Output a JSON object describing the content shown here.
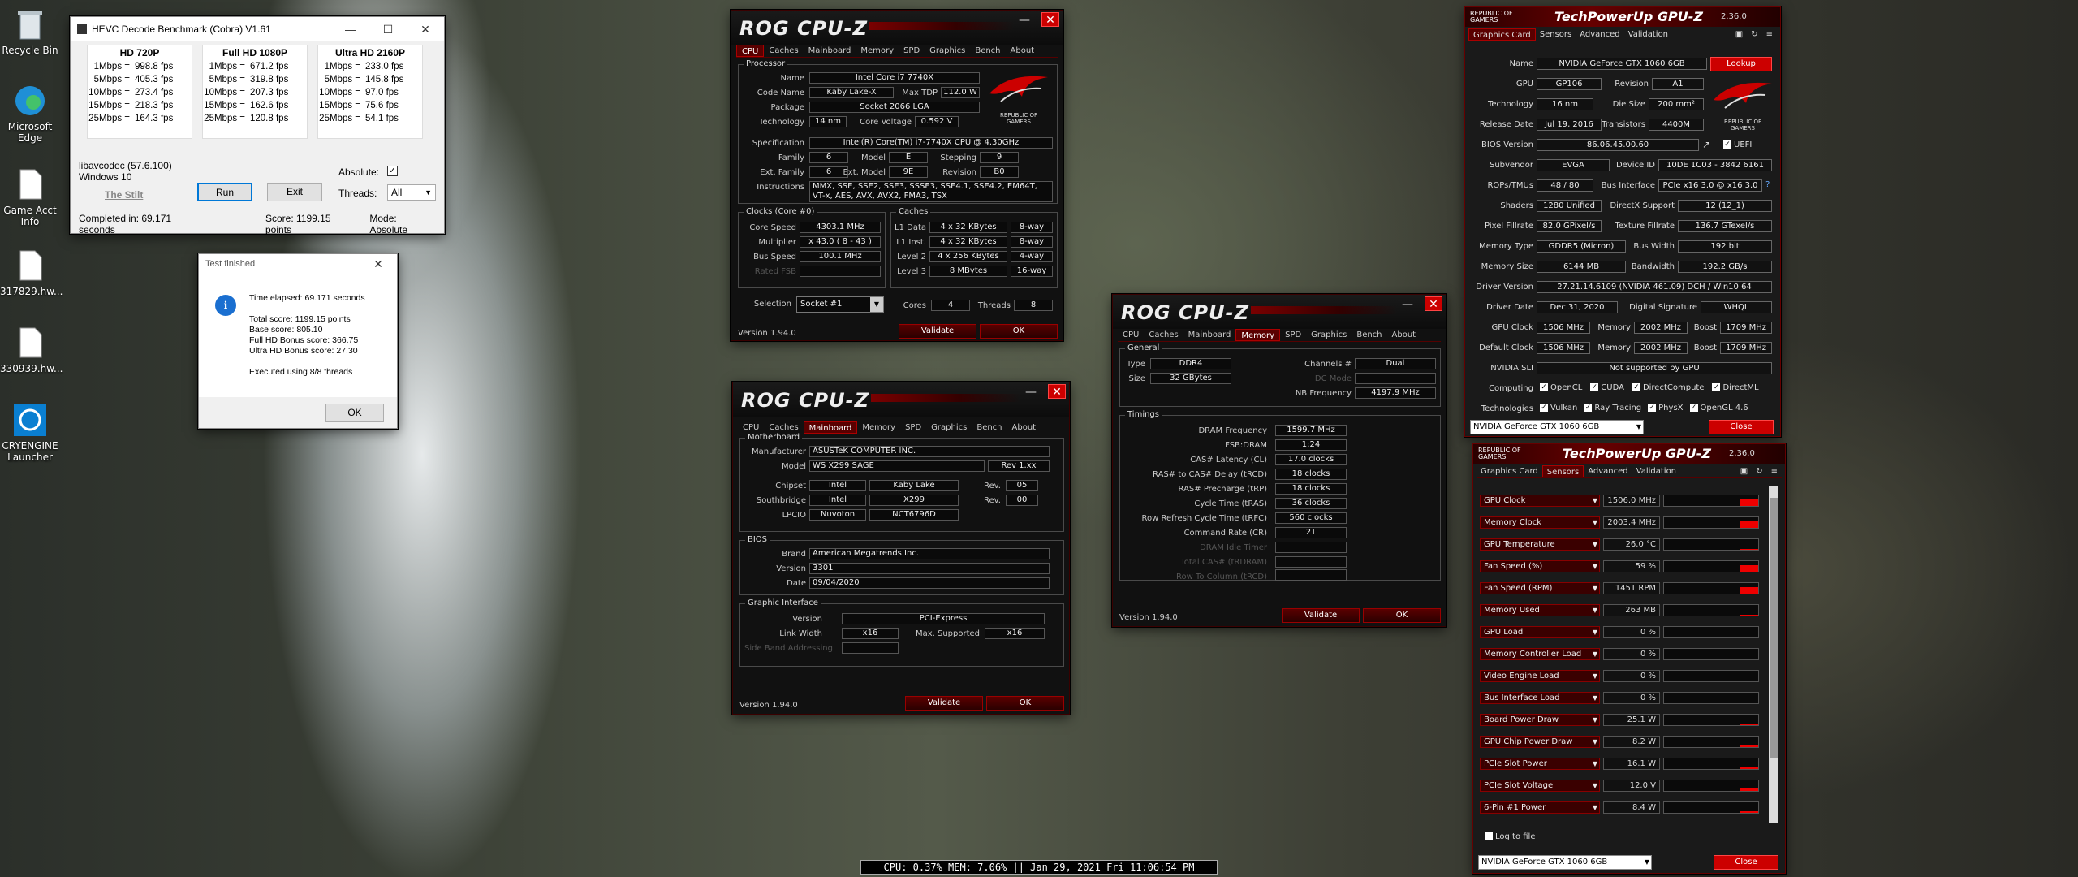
{
  "desktop": {
    "icons": [
      {
        "label": "Recycle Bin",
        "icon": "recycle-bin-icon"
      },
      {
        "label": "Microsoft Edge",
        "icon": "edge-icon"
      },
      {
        "label": "Game Acct Info",
        "icon": "document-icon"
      },
      {
        "label": "317829.hw...",
        "icon": "document-icon"
      },
      {
        "label": "330939.hw...",
        "icon": "document-icon"
      },
      {
        "label": "CRYENGINE Launcher",
        "icon": "cryengine-icon"
      }
    ]
  },
  "hevc": {
    "title": "HEVC Decode Benchmark (Cobra) V1.61",
    "cols": [
      {
        "h": "HD 720P",
        "rows": [
          [
            "1Mbps =",
            "998.8 fps"
          ],
          [
            "5Mbps =",
            "405.3 fps"
          ],
          [
            "10Mbps =",
            "273.4 fps"
          ],
          [
            "15Mbps =",
            "218.3 fps"
          ],
          [
            "25Mbps =",
            "164.3 fps"
          ]
        ]
      },
      {
        "h": "Full HD 1080P",
        "rows": [
          [
            "1Mbps =",
            "671.2 fps"
          ],
          [
            "5Mbps =",
            "319.8 fps"
          ],
          [
            "10Mbps =",
            "207.3 fps"
          ],
          [
            "15Mbps =",
            "162.6 fps"
          ],
          [
            "25Mbps =",
            "120.8 fps"
          ]
        ]
      },
      {
        "h": "Ultra HD 2160P",
        "rows": [
          [
            "1Mbps =",
            "233.0 fps"
          ],
          [
            "5Mbps =",
            "145.8 fps"
          ],
          [
            "10Mbps =",
            "97.0 fps"
          ],
          [
            "15Mbps =",
            "75.6 fps"
          ],
          [
            "25Mbps =",
            "54.1 fps"
          ]
        ]
      }
    ],
    "lib": "libavcodec (57.6.100)",
    "os": "Windows 10",
    "stilt": "The Stilt",
    "run": "Run",
    "exit": "Exit",
    "absolute": "Absolute:",
    "threads_label": "Threads:",
    "threads_value": "All",
    "status_time": "Completed in: 69.171 seconds",
    "status_score": "Score: 1199.15 points",
    "status_mode": "Mode: Absolute"
  },
  "dialog": {
    "title": "Test finished",
    "lines": [
      "Time elapsed:  69.171 seconds",
      "",
      "Total score:  1199.15 points",
      "Base score: 805.10",
      "Full HD Bonus score: 366.75",
      "Ultra HD Bonus score: 27.30",
      "",
      "Executed using 8/8 threads"
    ],
    "ok": "OK"
  },
  "cpuz1": {
    "logo": "ROG CPU-Z",
    "tabs": [
      "CPU",
      "Caches",
      "Mainboard",
      "Memory",
      "SPD",
      "Graphics",
      "Bench",
      "About"
    ],
    "proc": "Processor",
    "name_l": "Name",
    "name": "Intel Core i7 7740X",
    "code_l": "Code Name",
    "code": "Kaby Lake-X",
    "tdp_l": "Max TDP",
    "tdp": "112.0 W",
    "pkg_l": "Package",
    "pkg": "Socket 2066 LGA",
    "tech_l": "Technology",
    "tech": "14 nm",
    "cv_l": "Core Voltage",
    "cv": "0.592 V",
    "spec_l": "Specification",
    "spec": "Intel(R) Core(TM) i7-7740X CPU @ 4.30GHz",
    "fam_l": "Family",
    "fam": "6",
    "mod_l": "Model",
    "mod": "E",
    "step_l": "Stepping",
    "step": "9",
    "efam_l": "Ext. Family",
    "efam": "6",
    "emod_l": "Ext. Model",
    "emod": "9E",
    "rev_l": "Revision",
    "rev": "B0",
    "inst_l": "Instructions",
    "inst": "MMX, SSE, SSE2, SSE3, SSSE3, SSE4.1, SSE4.2, EM64T, VT-x, AES, AVX, AVX2, FMA3, TSX",
    "clocks": "Clocks (Core #0)",
    "cs_l": "Core Speed",
    "cs": "4303.1 MHz",
    "mul_l": "Multiplier",
    "mul": "x 43.0 ( 8 - 43 )",
    "bus_l": "Bus Speed",
    "bus": "100.1 MHz",
    "fsb_l": "Rated FSB",
    "caches": "Caches",
    "l1d_l": "L1 Data",
    "l1d": "4 x 32 KBytes",
    "l1d_w": "8-way",
    "l1i_l": "L1 Inst.",
    "l1i": "4 x 32 KBytes",
    "l1i_w": "8-way",
    "l2_l": "Level 2",
    "l2": "4 x 256 KBytes",
    "l2_w": "4-way",
    "l3_l": "Level 3",
    "l3": "8 MBytes",
    "l3_w": "16-way",
    "sel_l": "Selection",
    "sel": "Socket #1",
    "cores_l": "Cores",
    "cores": "4",
    "thr_l": "Threads",
    "thr": "8",
    "ver": "Version 1.94.0",
    "validate": "Validate",
    "ok": "OK"
  },
  "cpuz2": {
    "logo": "ROG CPU-Z",
    "tabs": [
      "CPU",
      "Caches",
      "Mainboard",
      "Memory",
      "SPD",
      "Graphics",
      "Bench",
      "About"
    ],
    "mb": "Motherboard",
    "man_l": "Manufacturer",
    "man": "ASUSTeK COMPUTER INC.",
    "model_l": "Model",
    "model": "WS X299 SAGE",
    "mrev": "Rev 1.xx",
    "chip_l": "Chipset",
    "chip1": "Intel",
    "chip2": "Kaby Lake",
    "chip_rev_l": "Rev.",
    "chip_rev": "05",
    "sb_l": "Southbridge",
    "sb1": "Intel",
    "sb2": "X299",
    "sb_rev_l": "Rev.",
    "sb_rev": "00",
    "lpc_l": "LPCIO",
    "lpc1": "Nuvoton",
    "lpc2": "NCT6796D",
    "bios": "BIOS",
    "brand_l": "Brand",
    "brand": "American Megatrends Inc.",
    "bver_l": "Version",
    "bver": "3301",
    "date_l": "Date",
    "date": "09/04/2020",
    "gi": "Graphic Interface",
    "gv_l": "Version",
    "gv": "PCI-Express",
    "lw_l": "Link Width",
    "lw": "x16",
    "ms_l": "Max. Supported",
    "ms": "x16",
    "sba_l": "Side Band Addressing",
    "ver": "Version 1.94.0",
    "validate": "Validate",
    "ok": "OK"
  },
  "cpuz3": {
    "logo": "ROG CPU-Z",
    "tabs": [
      "CPU",
      "Caches",
      "Mainboard",
      "Memory",
      "SPD",
      "Graphics",
      "Bench",
      "About"
    ],
    "gen": "General",
    "type_l": "Type",
    "type": "DDR4",
    "ch_l": "Channels #",
    "ch": "Dual",
    "size_l": "Size",
    "size": "32 GBytes",
    "dc_l": "DC Mode",
    "nb_l": "NB Frequency",
    "nb": "4197.9 MHz",
    "tim": "Timings",
    "rows": [
      [
        "DRAM Frequency",
        "1599.7 MHz"
      ],
      [
        "FSB:DRAM",
        "1:24"
      ],
      [
        "CAS# Latency (CL)",
        "17.0 clocks"
      ],
      [
        "RAS# to CAS# Delay (tRCD)",
        "18 clocks"
      ],
      [
        "RAS# Precharge (tRP)",
        "18 clocks"
      ],
      [
        "Cycle Time (tRAS)",
        "36 clocks"
      ],
      [
        "Row Refresh Cycle Time (tRFC)",
        "560 clocks"
      ],
      [
        "Command Rate (CR)",
        "2T"
      ],
      [
        "DRAM Idle Timer",
        ""
      ],
      [
        "Total CAS# (tRDRAM)",
        ""
      ],
      [
        "Row To Column (tRCD)",
        ""
      ]
    ],
    "ver": "Version 1.94.0",
    "validate": "Validate",
    "ok": "OK"
  },
  "gpuz1": {
    "rog": "REPUBLIC OF GAMERS",
    "title": "TechPowerUp GPU-Z",
    "ver": "2.36.0",
    "tabs": [
      "Graphics Card",
      "Sensors",
      "Advanced",
      "Validation"
    ],
    "name_l": "Name",
    "name": "NVIDIA GeForce GTX 1060 6GB",
    "lookup": "Lookup",
    "gpu_l": "GPU",
    "gpu": "GP106",
    "rev_l": "Revision",
    "rev": "A1",
    "tech_l": "Technology",
    "tech": "16 nm",
    "die_l": "Die Size",
    "die": "200 mm²",
    "rel_l": "Release Date",
    "rel": "Jul 19, 2016",
    "tr_l": "Transistors",
    "tr": "4400M",
    "bios_l": "BIOS Version",
    "bios": "86.06.45.00.60",
    "uefi": "UEFI",
    "sub_l": "Subvendor",
    "sub": "EVGA",
    "dev_l": "Device ID",
    "dev": "10DE 1C03 - 3842 6161",
    "rops_l": "ROPs/TMUs",
    "rops": "48 / 80",
    "bi_l": "Bus Interface",
    "bi": "PCIe x16 3.0 @ x16 3.0",
    "sh_l": "Shaders",
    "sh": "1280 Unified",
    "dx_l": "DirectX Support",
    "dx": "12 (12_1)",
    "pf_l": "Pixel Fillrate",
    "pf": "82.0 GPixel/s",
    "tf_l": "Texture Fillrate",
    "tf": "136.7 GTexel/s",
    "mt_l": "Memory Type",
    "mt": "GDDR5 (Micron)",
    "bw_l": "Bus Width",
    "bw": "192 bit",
    "ms_l": "Memory Size",
    "ms": "6144 MB",
    "band_l": "Bandwidth",
    "band": "192.2 GB/s",
    "drv_l": "Driver Version",
    "drv": "27.21.14.6109 (NVIDIA 461.09) DCH / Win10 64",
    "dd_l": "Driver Date",
    "dd": "Dec 31, 2020",
    "ds_l": "Digital Signature",
    "ds": "WHQL",
    "gc_l": "GPU Clock",
    "gc": "1506 MHz",
    "mem_l": "Memory",
    "mem": "2002 MHz",
    "boost_l": "Boost",
    "boost": "1709 MHz",
    "dc_l": "Default Clock",
    "dc": "1506 MHz",
    "mem2": "2002 MHz",
    "boost2": "1709 MHz",
    "sli_l": "NVIDIA SLI",
    "sli": "Not supported by GPU",
    "comp_l": "Computing",
    "comp": [
      "OpenCL",
      "CUDA",
      "DirectCompute",
      "DirectML"
    ],
    "techs_l": "Technologies",
    "techs": [
      "Vulkan",
      "Ray Tracing",
      "PhysX",
      "OpenGL 4.6"
    ],
    "select": "NVIDIA GeForce GTX 1060 6GB",
    "close": "Close"
  },
  "gpuz2": {
    "rog": "REPUBLIC OF GAMERS",
    "title": "TechPowerUp GPU-Z",
    "ver": "2.36.0",
    "tabs": [
      "Graphics Card",
      "Sensors",
      "Advanced",
      "Validation"
    ],
    "sensors": [
      {
        "n": "GPU Clock",
        "v": "1506.0 MHz",
        "f": 0.6
      },
      {
        "n": "Memory Clock",
        "v": "2003.4 MHz",
        "f": 0.6
      },
      {
        "n": "GPU Temperature",
        "v": "26.0 °C",
        "f": 0.05
      },
      {
        "n": "Fan Speed (%)",
        "v": "59 %",
        "f": 0.6
      },
      {
        "n": "Fan Speed (RPM)",
        "v": "1451 RPM",
        "f": 0.6
      },
      {
        "n": "Memory Used",
        "v": "263 MB",
        "f": 0.05
      },
      {
        "n": "GPU Load",
        "v": "0 %",
        "f": 0
      },
      {
        "n": "Memory Controller Load",
        "v": "0 %",
        "f": 0
      },
      {
        "n": "Video Engine Load",
        "v": "0 %",
        "f": 0
      },
      {
        "n": "Bus Interface Load",
        "v": "0 %",
        "f": 0
      },
      {
        "n": "Board Power Draw",
        "v": "25.1 W",
        "f": 0.15
      },
      {
        "n": "GPU Chip Power Draw",
        "v": "8.2 W",
        "f": 0.15
      },
      {
        "n": "PCIe Slot Power",
        "v": "16.1 W",
        "f": 0.15
      },
      {
        "n": "PCIe Slot Voltage",
        "v": "12.0 V",
        "f": 0.3
      },
      {
        "n": "6-Pin #1 Power",
        "v": "8.4 W",
        "f": 0.15
      }
    ],
    "log": "Log to file",
    "select": "NVIDIA GeForce GTX 1060 6GB",
    "close": "Close"
  },
  "taskbar": {
    "text": "CPU: 0.37%  MEM: 7.06%  ||  Jan 29, 2021  Fri  11:06:54 PM"
  }
}
